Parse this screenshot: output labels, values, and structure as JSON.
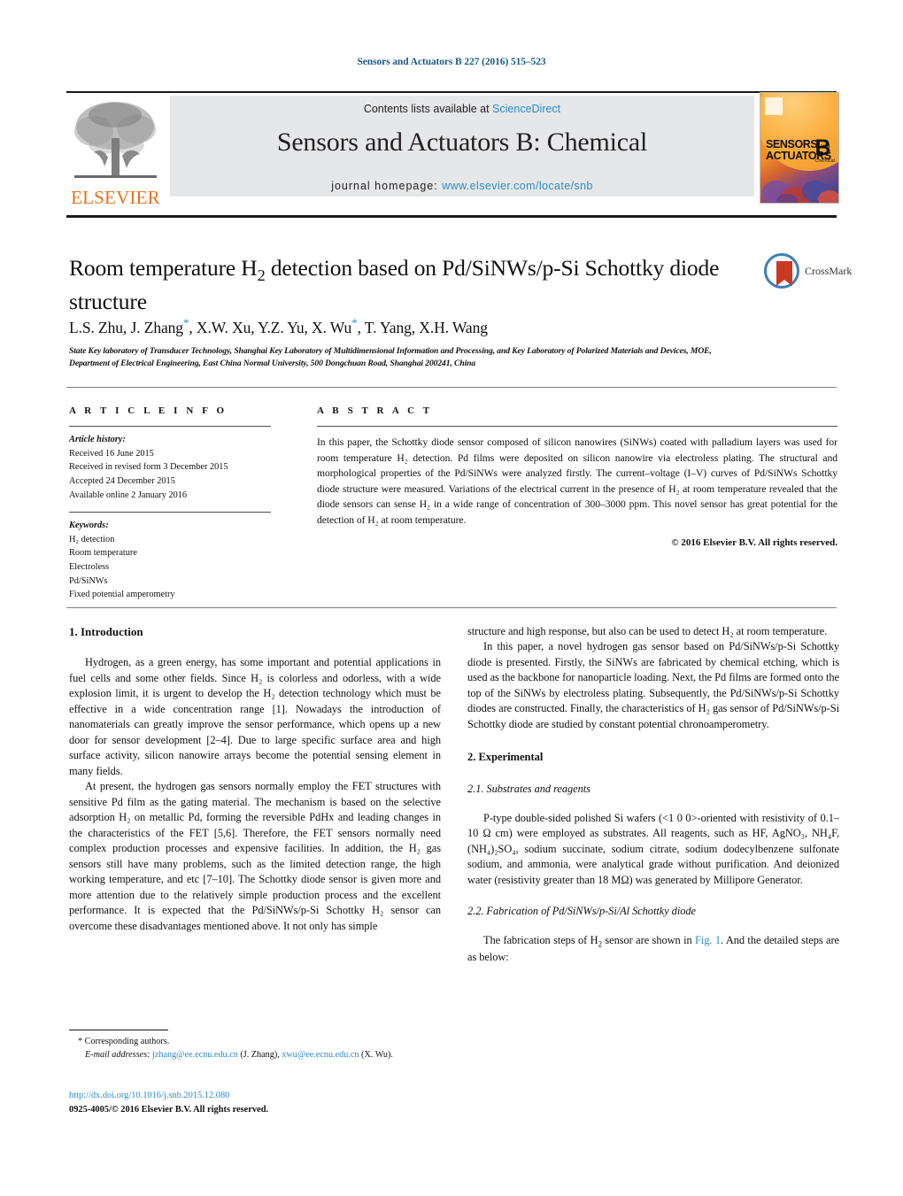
{
  "running_head": "Sensors and Actuators B 227 (2016) 515–523",
  "journal_header": {
    "contents_prefix": "Contents lists available at ",
    "sciencedirect": "ScienceDirect",
    "journal_title": "Sensors and Actuators B: Chemical",
    "homepage_prefix": "journal homepage: ",
    "homepage_url": "www.elsevier.com/locate/snb",
    "publisher_wordmark": "ELSEVIER",
    "cover": {
      "line1": "SENSORS",
      "line1_small": "and",
      "line2": "ACTUATORS",
      "volume_letter": "B",
      "volume_sub": "Chemical"
    }
  },
  "article": {
    "title": "Room temperature H₂ detection based on Pd/SiNWs/p-Si Schottky diode structure",
    "title_part1": "Room temperature H",
    "title_sub": "2",
    "title_part2": " detection based on Pd/SiNWs/p-Si Schottky diode structure",
    "authors": "L.S. Zhu, J. Zhang*, X.W. Xu, Y.Z. Yu, X. Wu*, T. Yang, X.H. Wang",
    "affiliation": "State Key laboratory of Transducer Technology, Shanghai Key Laboratory of Multidimensional Information and Processing, and Key Laboratory of Polarized Materials and Devices, MOE, Department of Electrical Engineering, East China Normal University, 500 Dongchuan Road, Shanghai 200241, China",
    "crossmark_label": "CrossMark"
  },
  "article_info": {
    "heading": "A R T I C L E   I N F O",
    "history_label": "Article history:",
    "history": [
      "Received 16 June 2015",
      "Received in revised form 3 December 2015",
      "Accepted 24 December 2015",
      "Available online 2 January 2016"
    ],
    "keywords_label": "Keywords:",
    "keywords": [
      "H₂ detection",
      "Room temperature",
      "Electroless",
      "Pd/SiNWs",
      "Fixed potential amperometry"
    ]
  },
  "abstract": {
    "heading": "A B S T R A C T",
    "body": "In this paper, the Schottky diode sensor composed of silicon nanowires (SiNWs) coated with palladium layers was used for room temperature H₂ detection. Pd films were deposited on silicon nanowire via electroless plating. The structural and morphological properties of the Pd/SiNWs were analyzed firstly. The current–voltage (I–V) curves of Pd/SiNWs Schottky diode structure were measured. Variations of the electrical current in the presence of H₂ at room temperature revealed that the diode sensors can sense H₂ in a wide range of concentration of 300–3000 ppm. This novel sensor has great potential for the detection of H₂ at room temperature.",
    "copyright": "© 2016 Elsevier B.V. All rights reserved."
  },
  "body": {
    "intro_heading": "1.  Introduction",
    "intro_p1": "Hydrogen, as a green energy, has some important and potential applications in fuel cells and some other fields. Since H₂ is colorless and odorless, with a wide explosion limit, it is urgent to develop the H₂ detection technology which must be effective in a wide concentration range [1]. Nowadays the introduction of nanomaterials can greatly improve the sensor performance, which opens up a new door for sensor development [2–4]. Due to large specific surface area and high surface activity, silicon nanowire arrays become the potential sensing element in many fields.",
    "intro_p2": "At present, the hydrogen gas sensors normally employ the FET structures with sensitive Pd film as the gating material. The mechanism is based on the selective adsorption H₂ on metallic Pd, forming the reversible PdHx and leading changes in the characteristics of the FET [5,6]. Therefore, the FET sensors normally need complex production processes and expensive facilities. In addition, the H₂ gas sensors still have many problems, such as the limited detection range, the high working temperature, and etc [7–10]. The Schottky diode sensor is given more and more attention due to the relatively simple production process and the excellent performance. It is expected that the Pd/SiNWs/p-Si Schottky H₂ sensor can overcome these disadvantages mentioned above. It not only has simple",
    "intro_p2_cont": "structure and high response, but also can be used to detect H₂ at room temperature.",
    "intro_p3": "In this paper, a novel hydrogen gas sensor based on Pd/SiNWs/p-Si Schottky diode is presented. Firstly, the SiNWs are fabricated by chemical etching, which is used as the backbone for nanoparticle loading. Next, the Pd films are formed onto the top of the SiNWs by electroless plating. Subsequently, the Pd/SiNWs/p-Si Schottky diodes are constructed. Finally, the characteristics of H₂ gas sensor of Pd/SiNWs/p-Si Schottky diode are studied by constant potential chronoamperometry.",
    "exp_heading": "2.  Experimental",
    "exp_sub1": "2.1.  Substrates and reagents",
    "exp_p1": "P-type double-sided polished Si wafers (<1 0 0>-oriented with resistivity of 0.1–10 Ω cm) were employed as substrates. All reagents, such as HF, AgNO₃, NH₄F, (NH₄)₂SO₄, sodium succinate, sodium citrate, sodium dodecylbenzene sulfonate sodium, and ammonia, were analytical grade without purification. And deionized water (resistivity greater than 18 MΩ) was generated by Millipore Generator.",
    "exp_sub2": "2.2.  Fabrication of Pd/SiNWs/p-Si/Al Schottky diode",
    "exp_p2": "The fabrication steps of H₂ sensor are shown in Fig. 1. And the detailed steps are as below:",
    "fig_ref": "Fig. 1"
  },
  "footnote": {
    "corresponding": "* Corresponding authors.",
    "email_label": "E-mail addresses:",
    "email1": "jzhang@ee.ecnu.edu.cn",
    "email1_owner": "(J. Zhang),",
    "email2": "xwu@ee.ecnu.edu.cn",
    "email2_owner": "(X. Wu)."
  },
  "imprint": {
    "doi": "http://dx.doi.org/10.1016/j.snb.2015.12.080",
    "issn_line": "0925-4005/© 2016 Elsevier B.V. All rights reserved."
  },
  "colors": {
    "link": "#2e8bc7",
    "running_head": "#1a5b86",
    "elsevier_orange": "#e8721c",
    "band_gray": "#e6e7e8"
  }
}
